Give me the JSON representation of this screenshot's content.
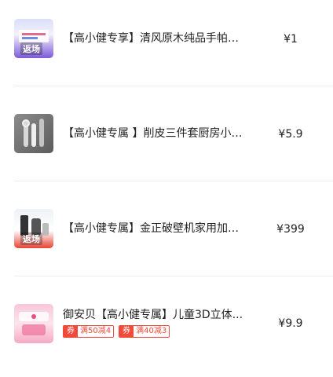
{
  "products": [
    {
      "title": "【高小健专享】清风原木纯品手帕纸巾...",
      "price": "¥1",
      "thumb_label": "返场",
      "thumb_icon": "tissue-pack-image"
    },
    {
      "title": "【高小健专属 】削皮三件套厨房小工具...",
      "price": "¥5.9",
      "thumb_icon": "peeler-set-image"
    },
    {
      "title": "【高小健专属】金正破壁机家用加热...",
      "price": "¥399",
      "thumb_label": "返场",
      "thumb_icon": "blender-image"
    },
    {
      "title": "御安贝【高小健专属】儿童3D立体...",
      "price": "¥9.9",
      "thumb_icon": "kids-product-image",
      "coupons": [
        {
          "tag": "券",
          "value": "满50减4"
        },
        {
          "tag": "券",
          "value": "满40减3"
        }
      ]
    }
  ],
  "colors": {
    "coupon_red": "#f04a3a",
    "divider": "#ececec"
  }
}
